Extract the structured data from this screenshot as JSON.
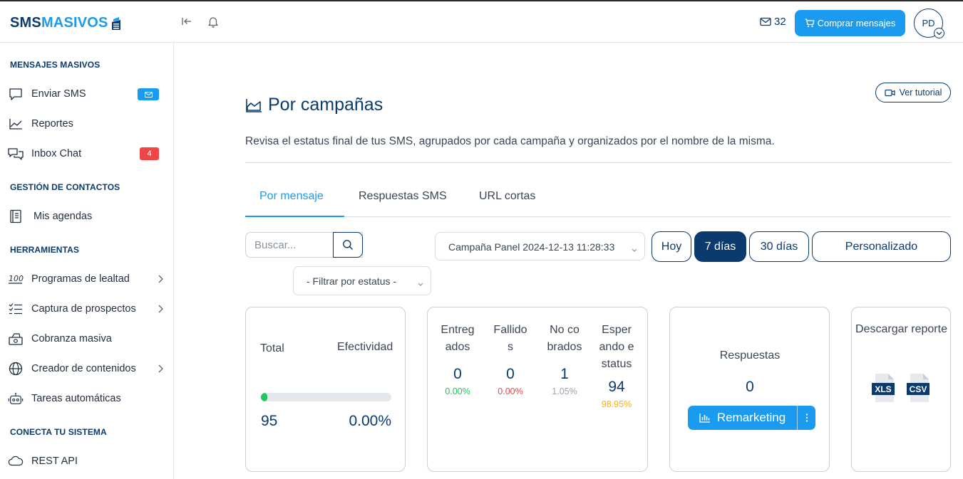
{
  "topbar": {
    "logo_part1": "SMS",
    "logo_part2": "MASIVOS",
    "credits": "32",
    "buy_label": "Comprar mensajes",
    "avatar_initials": "PD"
  },
  "sidebar": {
    "sections": [
      {
        "title": "MENSAJES MASIVOS"
      },
      {
        "title": "GESTIÓN DE CONTACTOS"
      },
      {
        "title": "HERRAMIENTAS"
      },
      {
        "title": "CONECTA TU SISTEMA"
      }
    ],
    "items": [
      {
        "label": "Enviar SMS",
        "icon": "message-square-icon"
      },
      {
        "label": "Reportes",
        "icon": "line-chart-icon"
      },
      {
        "label": "Inbox Chat",
        "icon": "chat-bubbles-icon",
        "badge": "4"
      },
      {
        "label": "Mis agendas",
        "icon": "address-book-icon"
      },
      {
        "label": "Programas de lealtad",
        "icon": "hundred-icon"
      },
      {
        "label": "Captura de prospectos",
        "icon": "checklist-icon"
      },
      {
        "label": "Cobranza masiva",
        "icon": "money-icon"
      },
      {
        "label": "Creador de contenidos",
        "icon": "globe-icon"
      },
      {
        "label": "Tareas automáticas",
        "icon": "robot-icon"
      },
      {
        "label": "REST API",
        "icon": "cloud-icon"
      }
    ]
  },
  "main": {
    "tutorial_label": "Ver tutorial",
    "title": "Por campañas",
    "description": "Revisa el estatus final de tus SMS, agrupados por cada campaña y organizados por el nombre de la misma.",
    "tabs": [
      {
        "label": "Por mensaje",
        "active": true
      },
      {
        "label": "Respuestas SMS",
        "active": false
      },
      {
        "label": "URL cortas",
        "active": false
      }
    ],
    "search_placeholder": "Buscar...",
    "campaign_selected": "Campaña Panel 2024-12-13 11:28:33",
    "status_filter": "- Filtrar por estatus -",
    "ranges": [
      {
        "label": "Hoy",
        "active": false
      },
      {
        "label": "7 días",
        "active": true
      },
      {
        "label": "30 días",
        "active": false
      },
      {
        "label": "Personalizado",
        "active": false
      }
    ],
    "summary": {
      "total_label": "Total",
      "effectivity_label": "Efectividad",
      "total_value": "95",
      "effectivity_value": "0.00%",
      "progress_fraction": 0.0
    },
    "stats": [
      {
        "label": "Entregados",
        "value": "0",
        "percent": "0.00%",
        "color": "#22c55e"
      },
      {
        "label": "Fallidos",
        "value": "0",
        "percent": "0.00%",
        "color": "#f04545"
      },
      {
        "label": "No cobrados",
        "value": "1",
        "percent": "1.05%",
        "color": "#9aa3ad"
      },
      {
        "label": "Esperando estatus",
        "value": "94",
        "percent": "98.95%",
        "color": "#f5b20a"
      }
    ],
    "responses": {
      "label": "Respuestas",
      "value": "0",
      "remarketing_label": "Remarketing"
    },
    "download": {
      "label": "Descargar reporte",
      "xls": "XLS",
      "csv": "CSV"
    }
  },
  "colors": {
    "brand_dark": "#0b3a6e",
    "brand_blue": "#1a9bef",
    "danger": "#f04545",
    "success": "#22c55e",
    "warning": "#f5b20a"
  }
}
